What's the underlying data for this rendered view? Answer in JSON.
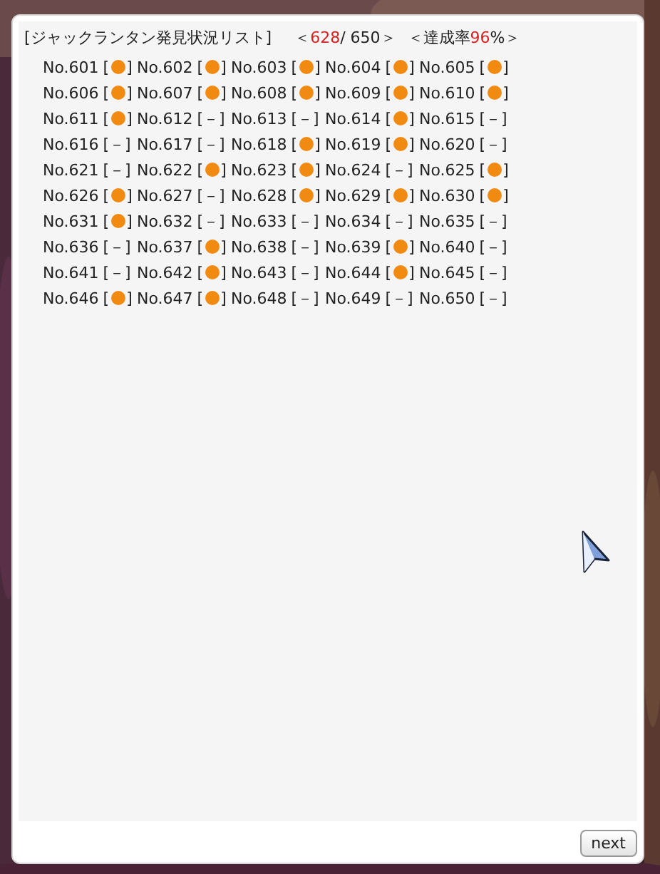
{
  "dialog": {
    "header": {
      "title": "[ジャックランタン発見状況リスト]",
      "count_open": "＜",
      "found": "628",
      "total": "/ 650＞",
      "rate_label": "＜達成率",
      "rate": "96",
      "rate_close": "%＞"
    },
    "items": [
      {
        "label": "No.601",
        "found": true,
        "open": "[",
        "close": "]"
      },
      {
        "label": "No.602",
        "found": true,
        "open": "[",
        "close": "]"
      },
      {
        "label": "No.603",
        "found": true,
        "open": "[",
        "close": "]"
      },
      {
        "label": "No.604",
        "found": true,
        "open": "[",
        "close": "]"
      },
      {
        "label": "No.605",
        "found": true,
        "open": "[",
        "close": "]"
      },
      {
        "label": "No.606",
        "found": true,
        "open": "[",
        "close": "]"
      },
      {
        "label": "No.607",
        "found": true,
        "open": "[",
        "close": "]"
      },
      {
        "label": "No.608",
        "found": true,
        "open": "[",
        "close": "]"
      },
      {
        "label": "No.609",
        "found": true,
        "open": "[",
        "close": "]"
      },
      {
        "label": "No.610",
        "found": true,
        "open": "[",
        "close": "]"
      },
      {
        "label": "No.611",
        "found": true,
        "open": "[",
        "close": "]"
      },
      {
        "label": "No.612",
        "found": false,
        "status": "[－]"
      },
      {
        "label": "No.613",
        "found": false,
        "status": "[－]"
      },
      {
        "label": "No.614",
        "found": true,
        "open": "[",
        "close": "]"
      },
      {
        "label": "No.615",
        "found": false,
        "status": "[－]"
      },
      {
        "label": "No.616",
        "found": false,
        "status": "[－]"
      },
      {
        "label": "No.617",
        "found": false,
        "status": "[－]"
      },
      {
        "label": "No.618",
        "found": true,
        "open": "[",
        "close": "]"
      },
      {
        "label": "No.619",
        "found": true,
        "open": "[",
        "close": "]"
      },
      {
        "label": "No.620",
        "found": false,
        "status": "[－]"
      },
      {
        "label": "No.621",
        "found": false,
        "status": "[－]"
      },
      {
        "label": "No.622",
        "found": true,
        "open": "[",
        "close": "]"
      },
      {
        "label": "No.623",
        "found": true,
        "open": "[",
        "close": "]"
      },
      {
        "label": "No.624",
        "found": false,
        "status": "[－]"
      },
      {
        "label": "No.625",
        "found": true,
        "open": "[",
        "close": "]"
      },
      {
        "label": "No.626",
        "found": true,
        "open": "[",
        "close": "]"
      },
      {
        "label": "No.627",
        "found": false,
        "status": "[－]"
      },
      {
        "label": "No.628",
        "found": true,
        "open": "[",
        "close": "]"
      },
      {
        "label": "No.629",
        "found": true,
        "open": "[",
        "close": "]"
      },
      {
        "label": "No.630",
        "found": true,
        "open": "[",
        "close": "]"
      },
      {
        "label": "No.631",
        "found": true,
        "open": "[",
        "close": "]"
      },
      {
        "label": "No.632",
        "found": false,
        "status": "[－]"
      },
      {
        "label": "No.633",
        "found": false,
        "status": "[－]"
      },
      {
        "label": "No.634",
        "found": false,
        "status": "[－]"
      },
      {
        "label": "No.635",
        "found": false,
        "status": "[－]"
      },
      {
        "label": "No.636",
        "found": false,
        "status": "[－]"
      },
      {
        "label": "No.637",
        "found": true,
        "open": "[",
        "close": "]"
      },
      {
        "label": "No.638",
        "found": false,
        "status": "[－]"
      },
      {
        "label": "No.639",
        "found": true,
        "open": "[",
        "close": "]"
      },
      {
        "label": "No.640",
        "found": false,
        "status": "[－]"
      },
      {
        "label": "No.641",
        "found": false,
        "status": "[－]"
      },
      {
        "label": "No.642",
        "found": true,
        "open": "[",
        "close": "]"
      },
      {
        "label": "No.643",
        "found": false,
        "status": "[－]"
      },
      {
        "label": "No.644",
        "found": true,
        "open": "[",
        "close": "]"
      },
      {
        "label": "No.645",
        "found": false,
        "status": "[－]"
      },
      {
        "label": "No.646",
        "found": true,
        "open": "[",
        "close": "]"
      },
      {
        "label": "No.647",
        "found": true,
        "open": "[",
        "close": "]"
      },
      {
        "label": "No.648",
        "found": false,
        "status": "[－]"
      },
      {
        "label": "No.649",
        "found": false,
        "status": "[－]"
      },
      {
        "label": "No.650",
        "found": false,
        "status": "[－]"
      }
    ],
    "next_button": "next"
  }
}
